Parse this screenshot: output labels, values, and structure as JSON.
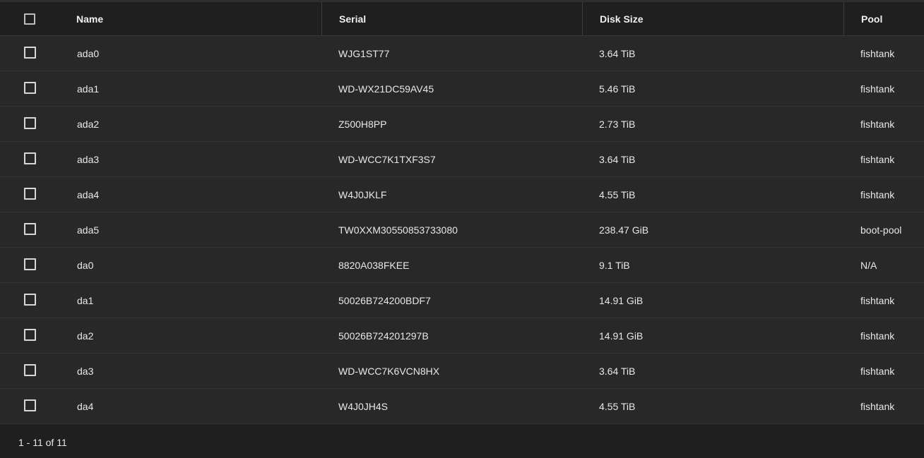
{
  "table": {
    "columns": {
      "name": "Name",
      "serial": "Serial",
      "disk_size": "Disk Size",
      "pool": "Pool"
    },
    "rows": [
      {
        "name": "ada0",
        "serial": "WJG1ST77",
        "disk_size": "3.64 TiB",
        "pool": "fishtank"
      },
      {
        "name": "ada1",
        "serial": "WD-WX21DC59AV45",
        "disk_size": "5.46 TiB",
        "pool": "fishtank"
      },
      {
        "name": "ada2",
        "serial": "Z500H8PP",
        "disk_size": "2.73 TiB",
        "pool": "fishtank"
      },
      {
        "name": "ada3",
        "serial": "WD-WCC7K1TXF3S7",
        "disk_size": "3.64 TiB",
        "pool": "fishtank"
      },
      {
        "name": "ada4",
        "serial": "W4J0JKLF",
        "disk_size": "4.55 TiB",
        "pool": "fishtank"
      },
      {
        "name": "ada5",
        "serial": "TW0XXM30550853733080",
        "disk_size": "238.47 GiB",
        "pool": "boot-pool"
      },
      {
        "name": "da0",
        "serial": "8820A038FKEE",
        "disk_size": "9.1 TiB",
        "pool": "N/A"
      },
      {
        "name": "da1",
        "serial": "50026B724200BDF7",
        "disk_size": "14.91 GiB",
        "pool": "fishtank"
      },
      {
        "name": "da2",
        "serial": "50026B724201297B",
        "disk_size": "14.91 GiB",
        "pool": "fishtank"
      },
      {
        "name": "da3",
        "serial": "WD-WCC7K6VCN8HX",
        "disk_size": "3.64 TiB",
        "pool": "fishtank"
      },
      {
        "name": "da4",
        "serial": "W4J0JH4S",
        "disk_size": "4.55 TiB",
        "pool": "fishtank"
      }
    ]
  },
  "footer": {
    "range_text": "1 - 11 of 11"
  }
}
